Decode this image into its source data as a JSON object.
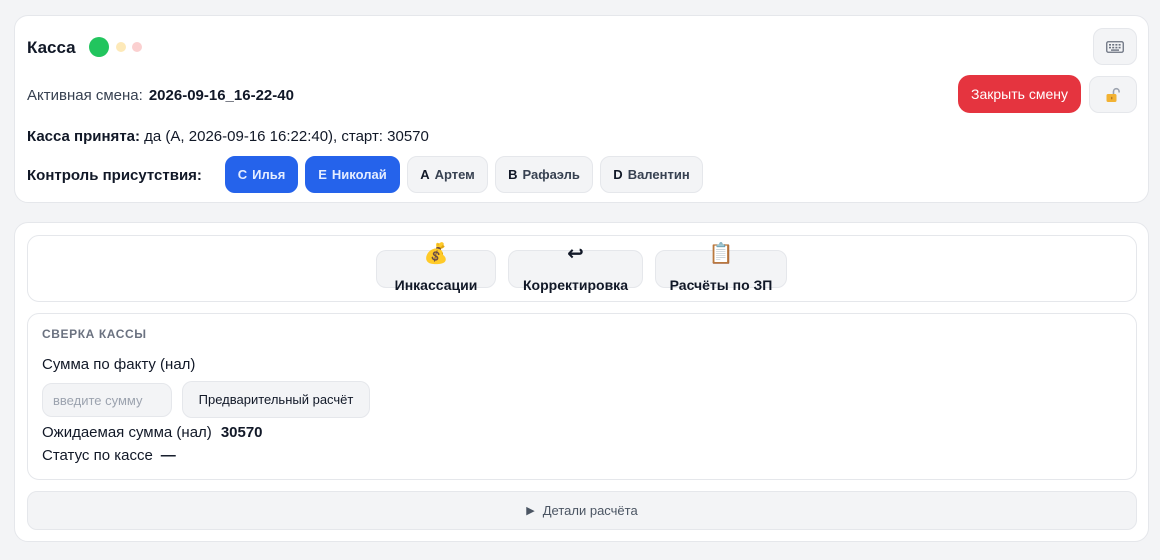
{
  "header": {
    "title": "Касса",
    "status_dots": [
      "#22c55e",
      "#fde9b8",
      "#fbd0d0"
    ],
    "keyboard_icon": "keyboard-icon",
    "lock_icon": "unlock-icon"
  },
  "shift": {
    "label": "Активная смена:",
    "value": "2026-09-16_16-22-40",
    "close_button": "Закрыть смену"
  },
  "accepted": {
    "label": "Касса принята:",
    "value": "да (А, 2026-09-16 16:22:40), старт: 30570"
  },
  "presence": {
    "label": "Контроль присутствия:",
    "chips": [
      {
        "letter": "C",
        "name": "Илья",
        "active": true
      },
      {
        "letter": "E",
        "name": "Николай",
        "active": true
      },
      {
        "letter": "A",
        "name": "Артем",
        "active": false
      },
      {
        "letter": "B",
        "name": "Рафаэль",
        "active": false
      },
      {
        "letter": "D",
        "name": "Валентин",
        "active": false
      }
    ]
  },
  "actions": [
    {
      "icon": "💰",
      "icon_name": "money-bag-icon",
      "label": "Инкассации"
    },
    {
      "icon": "↩",
      "icon_name": "return-arrow-icon",
      "label": "Корректировка"
    },
    {
      "icon": "📋",
      "icon_name": "clipboard-icon",
      "label": "Расчёты по ЗП"
    }
  ],
  "reconciliation": {
    "title": "СВЕРКА КАССЫ",
    "fact_label": "Сумма по факту (нал)",
    "input_placeholder": "введите сумму",
    "input_value": "",
    "prelim_button": "Предварительный расчёт",
    "expected_label": "Ожидаемая сумма (нал)",
    "expected_value": "30570",
    "status_label": "Статус по кассе",
    "status_value": "—"
  },
  "details": {
    "label": "Детали расчёта"
  },
  "colors": {
    "accent": "#2563eb",
    "danger": "#e5343f"
  }
}
